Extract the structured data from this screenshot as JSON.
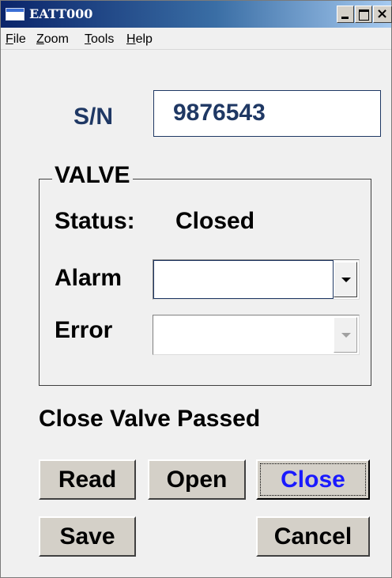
{
  "window": {
    "title": "EATT000",
    "icon": "app-window-icon",
    "controls": {
      "minimize_icon": "minimize-icon",
      "maximize_icon": "maximize-icon",
      "close_glyph": "×"
    }
  },
  "menu": {
    "file": {
      "accel": "F",
      "rest": "ile"
    },
    "zoom": {
      "accel": "Z",
      "rest": "oom"
    },
    "tools": {
      "accel": "T",
      "rest": "ools"
    },
    "help": {
      "accel": "H",
      "rest": "elp"
    }
  },
  "serial": {
    "label": "S/N",
    "value": "9876543"
  },
  "valve": {
    "group_title": "VALVE",
    "status_label": "Status:",
    "status_value": "Closed",
    "alarm_label": "Alarm",
    "alarm_value": "",
    "error_label": "Error",
    "error_value": ""
  },
  "message": "Close Valve Passed",
  "buttons": {
    "read": "Read",
    "open": "Open",
    "close": "Close",
    "save": "Save",
    "cancel": "Cancel"
  },
  "colors": {
    "accent_text": "#1f3864",
    "focused_button_text": "#1a1aff",
    "title_bar": "#0a246a"
  }
}
